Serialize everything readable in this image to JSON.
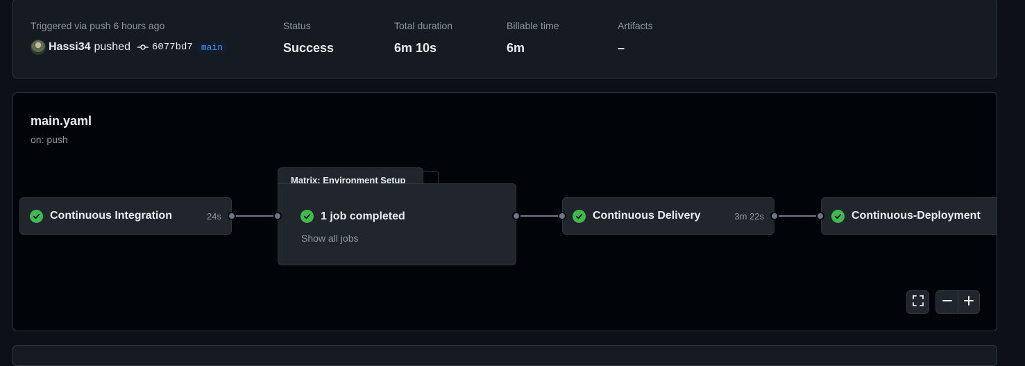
{
  "summary": {
    "trigger_label": "Triggered via push 6 hours ago",
    "actor": "Hassi34",
    "action": "pushed",
    "commit_sha": "6077bd7",
    "branch": "main",
    "status_label": "Status",
    "status_value": "Success",
    "duration_label": "Total duration",
    "duration_value": "6m 10s",
    "billable_label": "Billable time",
    "billable_value": "6m",
    "artifacts_label": "Artifacts",
    "artifacts_value": "–"
  },
  "workflow": {
    "title": "main.yaml",
    "trigger": "on: push",
    "jobs": [
      {
        "name": "Continuous Integration",
        "duration": "24s",
        "status": "success"
      },
      {
        "name": "Continuous Delivery",
        "duration": "3m 22s",
        "status": "success"
      },
      {
        "name": "Continuous-Deployment",
        "duration": "",
        "status": "success"
      }
    ],
    "matrix": {
      "title": "Matrix: Environment Setup",
      "summary": "1 job completed",
      "link": "Show all jobs"
    }
  },
  "colors": {
    "success": "#3fb950",
    "background": "#0d1117",
    "panel": "#161b22",
    "graph_bg": "#010409",
    "node": "#21262d",
    "border": "#30363d",
    "muted_text": "#8d96a0",
    "branch_link": "#4493f8"
  },
  "icons": {
    "commit": "git-commit-icon",
    "success": "check-circle-icon",
    "fullscreen": "fullscreen-icon",
    "zoom_out": "minus-icon",
    "zoom_in": "plus-icon"
  }
}
